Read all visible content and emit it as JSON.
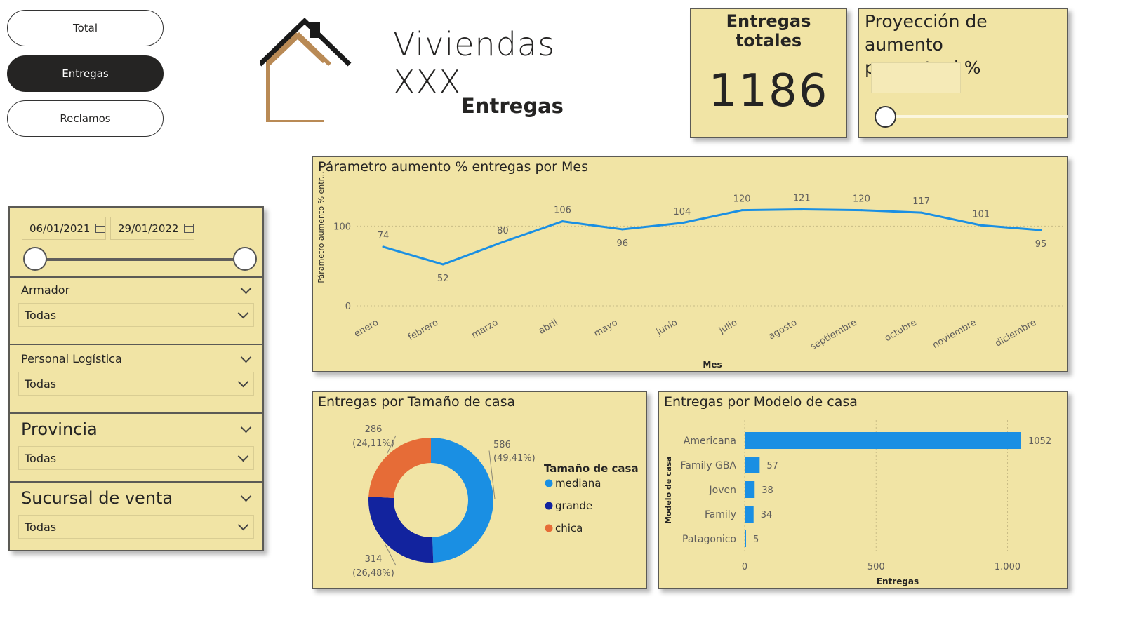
{
  "nav": {
    "total": "Total",
    "entregas": "Entregas",
    "reclamos": "Reclamos"
  },
  "header": {
    "title": "Viviendas XXX",
    "subtitle": "Entregas"
  },
  "kpi": {
    "title": "Entregas totales",
    "value": "1186"
  },
  "projection": {
    "title_line1": "Proyección de aumento",
    "title_line2": "porcentual %"
  },
  "date_range": {
    "start": "06/01/2021",
    "end": "29/01/2022"
  },
  "slicers": [
    {
      "label": "Armador",
      "value": "Todas"
    },
    {
      "label": "Personal Logística",
      "value": "Todas"
    },
    {
      "label": "Provincia",
      "value": "Todas"
    },
    {
      "label": "Sucursal de venta",
      "value": "Todas"
    }
  ],
  "colors": {
    "card_bg": "#f1e4a5",
    "line": "#1a8fe3",
    "mediana": "#1a8fe3",
    "grande": "#12239e",
    "chica": "#e66c37",
    "bar": "#1a8fe3"
  },
  "chart_data": [
    {
      "type": "line",
      "title": "Párametro aumento % entregas por Mes",
      "xlabel": "Mes",
      "ylabel": "Párametro aumento % entr...",
      "categories": [
        "enero",
        "febrero",
        "marzo",
        "abril",
        "mayo",
        "junio",
        "julio",
        "agosto",
        "septiembre",
        "octubre",
        "noviembre",
        "diciembre"
      ],
      "values": [
        74,
        52,
        80,
        106,
        96,
        104,
        120,
        121,
        120,
        117,
        101,
        95
      ],
      "yticks": [
        0,
        100
      ],
      "ylim": [
        0,
        125
      ],
      "grid": true
    },
    {
      "type": "pie",
      "title": "Entregas por Tamaño de casa",
      "legend_title": "Tamaño de casa",
      "legend_position": "right",
      "slices": [
        {
          "name": "mediana",
          "value": 586,
          "label_value": "586",
          "label_pct": "(49,41%)"
        },
        {
          "name": "grande",
          "value": 314,
          "label_value": "314",
          "label_pct": "(26,48%)"
        },
        {
          "name": "chica",
          "value": 286,
          "label_value": "286",
          "label_pct": "(24,11%)"
        }
      ]
    },
    {
      "type": "bar",
      "orientation": "horizontal",
      "title": "Entregas por Modelo de casa",
      "xlabel": "Entregas",
      "ylabel": "Modelo de casa",
      "categories": [
        "Americana",
        "Family GBA",
        "Joven",
        "Family",
        "Patagonico"
      ],
      "values": [
        1052,
        57,
        38,
        34,
        5
      ],
      "xticks": [
        "0",
        "500",
        "1.000"
      ],
      "xtick_values": [
        0,
        500,
        1000
      ],
      "xlim": [
        0,
        1052
      ]
    }
  ]
}
